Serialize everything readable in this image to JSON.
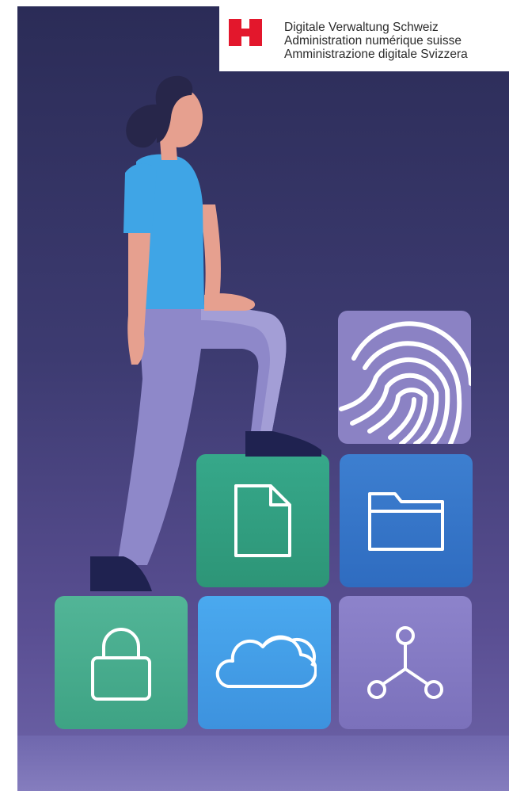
{
  "header": {
    "line_de": "Digitale Verwaltung Schweiz",
    "line_fr": "Administration numérique suisse",
    "line_it": "Amministrazione digitale Svizzera"
  },
  "colors": {
    "brand_red": "#e3172c",
    "background_top": "#2b2c57",
    "background_bottom": "#6f65aa",
    "tile_green": "#2d9577",
    "tile_blue": "#2f6cc0",
    "tile_sky": "#3d92de",
    "tile_violet": "#7b71bb"
  },
  "illustration": {
    "icons": [
      "fingerprint-icon",
      "document-icon",
      "folder-icon",
      "lock-icon",
      "cloud-icon",
      "network-icon"
    ]
  }
}
